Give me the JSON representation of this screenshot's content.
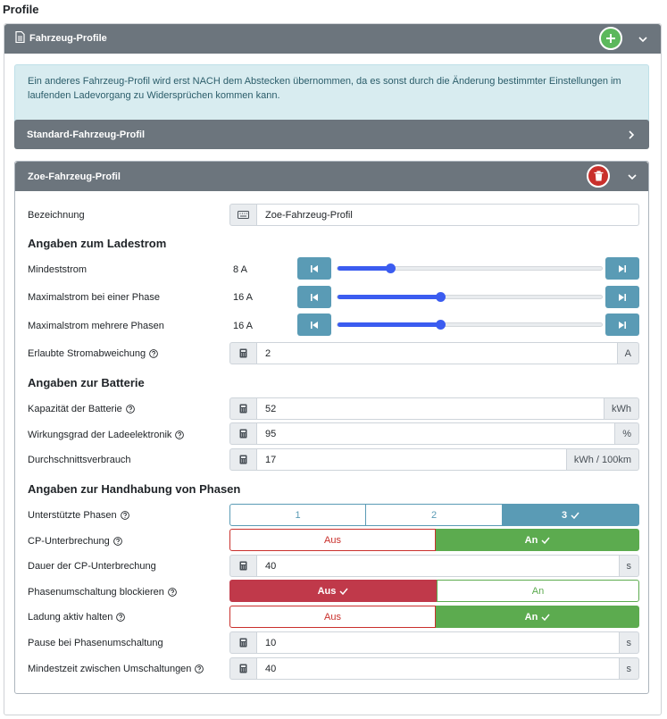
{
  "page": {
    "title": "Profile"
  },
  "header": {
    "title": "Fahrzeug-Profile"
  },
  "alert": {
    "text": "Ein anderes Fahrzeug-Profil wird erst NACH dem Abstecken übernommen, da es sonst durch die Änderung bestimmter Einstellungen im laufenden Ladevorgang zu Widersprüchen kommen kann."
  },
  "standard_profile": {
    "title": "Standard-Fahrzeug-Profil"
  },
  "zoe_profile": {
    "title": "Zoe-Fahrzeug-Profil",
    "bezeichnung": {
      "label": "Bezeichnung",
      "value": "Zoe-Fahrzeug-Profil"
    },
    "ladestrom": {
      "title": "Angaben zum Ladestrom",
      "mindeststrom": {
        "label": "Mindeststrom",
        "value": "8 A",
        "level": 0.2
      },
      "max_eine_phase": {
        "label": "Maximalstrom bei einer Phase",
        "value": "16 A",
        "level": 0.389
      },
      "max_mehrere_phasen": {
        "label": "Maximalstrom mehrere Phasen",
        "value": "16 A",
        "level": 0.389
      },
      "abweichung": {
        "label": "Erlaubte Stromabweichung",
        "value": "2",
        "unit": "A"
      }
    },
    "batterie": {
      "title": "Angaben zur Batterie",
      "kapazitaet": {
        "label": "Kapazität der Batterie",
        "value": "52",
        "unit": "kWh"
      },
      "wirkungsgrad": {
        "label": "Wirkungsgrad der Ladeelektronik",
        "value": "95",
        "unit": "%"
      },
      "verbrauch": {
        "label": "Durchschnittsverbrauch",
        "value": "17",
        "unit": "kWh / 100km"
      }
    },
    "phasen": {
      "title": "Angaben zur Handhabung von Phasen",
      "unterstuetzt": {
        "label": "Unterstützte Phasen",
        "options": [
          "1",
          "2",
          "3"
        ],
        "selected": "3"
      },
      "cp_unterbrechung": {
        "label": "CP-Unterbrechung",
        "off": "Aus",
        "on": "An",
        "selected": "An"
      },
      "cp_dauer": {
        "label": "Dauer der CP-Unterbrechung",
        "value": "40",
        "unit": "s"
      },
      "umschaltung_blockieren": {
        "label": "Phasenumschaltung blockieren",
        "off": "Aus",
        "on": "An",
        "selected": "Aus"
      },
      "ladung_aktiv": {
        "label": "Ladung aktiv halten",
        "off": "Aus",
        "on": "An",
        "selected": "An"
      },
      "pause": {
        "label": "Pause bei Phasenumschaltung",
        "value": "10",
        "unit": "s"
      },
      "mindestzeit": {
        "label": "Mindestzeit zwischen Umschaltungen",
        "value": "40",
        "unit": "s"
      }
    }
  },
  "colors": {
    "header": "#6c757d",
    "info": "#5a9bb5",
    "success": "#5cab4f",
    "danger": "#c0394a",
    "slider": "#3b5cf0"
  }
}
